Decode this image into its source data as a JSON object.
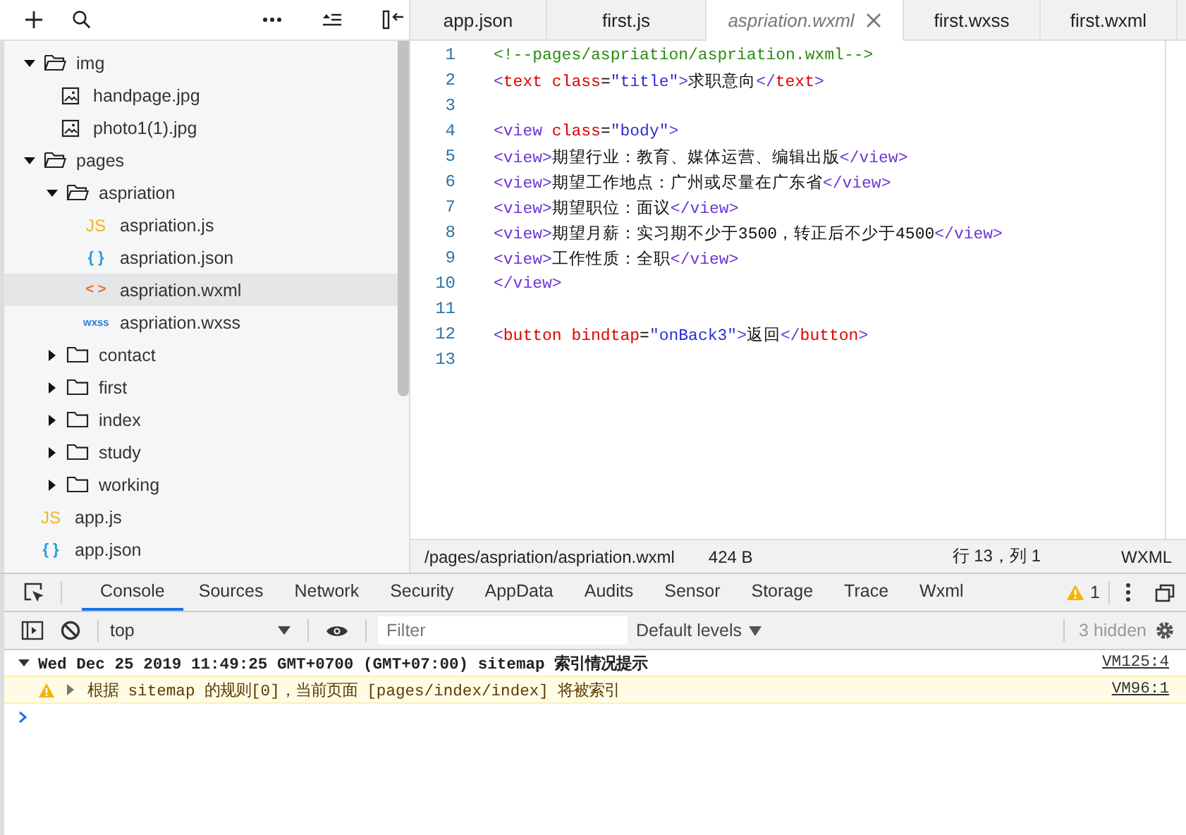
{
  "sidebar": {
    "tree": [
      {
        "name": "img",
        "kind": "folder",
        "expanded": true,
        "selected": false,
        "children": [
          {
            "name": "handpage.jpg",
            "kind": "image",
            "selected": false
          },
          {
            "name": "photo1(1).jpg",
            "kind": "image",
            "selected": false
          }
        ]
      },
      {
        "name": "pages",
        "kind": "folder",
        "expanded": true,
        "selected": false,
        "children": [
          {
            "name": "aspriation",
            "kind": "folder",
            "expanded": true,
            "selected": false,
            "children": [
              {
                "name": "aspriation.js",
                "kind": "js",
                "badge": "JS",
                "selected": false
              },
              {
                "name": "aspriation.json",
                "kind": "json",
                "badge": "{ }",
                "selected": false
              },
              {
                "name": "aspriation.wxml",
                "kind": "wxml",
                "badge": "< >",
                "selected": true
              },
              {
                "name": "aspriation.wxss",
                "kind": "wxss",
                "badge": "wxss",
                "selected": false
              }
            ]
          },
          {
            "name": "contact",
            "kind": "folder",
            "expanded": false,
            "selected": false
          },
          {
            "name": "first",
            "kind": "folder",
            "expanded": false,
            "selected": false
          },
          {
            "name": "index",
            "kind": "folder",
            "expanded": false,
            "selected": false
          },
          {
            "name": "study",
            "kind": "folder",
            "expanded": false,
            "selected": false
          },
          {
            "name": "working",
            "kind": "folder",
            "expanded": false,
            "selected": false
          }
        ]
      },
      {
        "name": "app.js",
        "kind": "js",
        "badge": "JS",
        "selected": false
      },
      {
        "name": "app.json",
        "kind": "json",
        "badge": "{ }",
        "selected": false
      }
    ]
  },
  "editor": {
    "tabs": [
      {
        "label": "app.json",
        "selected": false
      },
      {
        "label": "first.js",
        "selected": false
      },
      {
        "label": "aspriation.wxml",
        "selected": true
      },
      {
        "label": "first.wxss",
        "selected": false
      },
      {
        "label": "first.wxml",
        "selected": false
      }
    ],
    "lines": [
      {
        "number": "1",
        "tokens": [
          {
            "kind": "comment",
            "text": "<!--pages/aspriation/aspriation.wxml-->"
          }
        ]
      },
      {
        "number": "2",
        "tokens": [
          {
            "kind": "punct",
            "text": "<"
          },
          {
            "kind": "keyword",
            "text": "text"
          },
          {
            "kind": "keyword",
            "text": " class"
          },
          {
            "kind": "text",
            "text": "="
          },
          {
            "kind": "string",
            "text": "\"title\""
          },
          {
            "kind": "punct",
            "text": ">"
          },
          {
            "kind": "text",
            "text": "求职意向"
          },
          {
            "kind": "punct",
            "text": "</"
          },
          {
            "kind": "keyword",
            "text": "text"
          },
          {
            "kind": "punct",
            "text": ">"
          }
        ]
      },
      {
        "number": "3"
      },
      {
        "number": "4",
        "tokens": [
          {
            "kind": "tag",
            "text": "<view"
          },
          {
            "kind": "keyword",
            "text": " class"
          },
          {
            "kind": "text",
            "text": "="
          },
          {
            "kind": "string",
            "text": "\"body\""
          },
          {
            "kind": "tag",
            "text": ">"
          }
        ]
      },
      {
        "number": "5",
        "tokens": [
          {
            "kind": "tag",
            "text": "<view>"
          },
          {
            "kind": "text",
            "text": "期望行业：教育、媒体运营、编辑出版"
          },
          {
            "kind": "tag",
            "text": "</view>"
          }
        ]
      },
      {
        "number": "6",
        "tokens": [
          {
            "kind": "tag",
            "text": "<view>"
          },
          {
            "kind": "text",
            "text": "期望工作地点：广州或尽量在广东省"
          },
          {
            "kind": "tag",
            "text": "</view>"
          }
        ]
      },
      {
        "number": "7",
        "tokens": [
          {
            "kind": "tag",
            "text": "<view>"
          },
          {
            "kind": "text",
            "text": "期望职位：面议"
          },
          {
            "kind": "tag",
            "text": "</view>"
          }
        ]
      },
      {
        "number": "8",
        "tokens": [
          {
            "kind": "tag",
            "text": "<view>"
          },
          {
            "kind": "text",
            "text": "期望月薪：实习期不少于3500，转正后不少于4500"
          },
          {
            "kind": "tag",
            "text": "</view>"
          }
        ]
      },
      {
        "number": "9",
        "tokens": [
          {
            "kind": "tag",
            "text": "<view>"
          },
          {
            "kind": "text",
            "text": "工作性质：全职"
          },
          {
            "kind": "tag",
            "text": "</view>"
          }
        ]
      },
      {
        "number": "10",
        "tokens": [
          {
            "kind": "tag",
            "text": "</view>"
          }
        ]
      },
      {
        "number": "11"
      },
      {
        "number": "12",
        "tokens": [
          {
            "kind": "punct",
            "text": "<"
          },
          {
            "kind": "keyword",
            "text": "button"
          },
          {
            "kind": "keyword",
            "text": " bindtap"
          },
          {
            "kind": "text",
            "text": "="
          },
          {
            "kind": "string",
            "text": "\"onBack3\""
          },
          {
            "kind": "punct",
            "text": ">"
          },
          {
            "kind": "text",
            "text": "返回"
          },
          {
            "kind": "punct",
            "text": "</"
          },
          {
            "kind": "keyword",
            "text": "button"
          },
          {
            "kind": "punct",
            "text": ">"
          }
        ]
      },
      {
        "number": "13"
      }
    ],
    "status_bar": {
      "path": "/pages/aspriation/aspriation.wxml",
      "size": "424 B",
      "position": "行 13，列 1",
      "language": "WXML"
    }
  },
  "devtools": {
    "tabs": [
      {
        "label": "Console",
        "selected": true
      },
      {
        "label": "Sources",
        "selected": false
      },
      {
        "label": "Network",
        "selected": false
      },
      {
        "label": "Security",
        "selected": false
      },
      {
        "label": "AppData",
        "selected": false
      },
      {
        "label": "Audits",
        "selected": false
      },
      {
        "label": "Sensor",
        "selected": false
      },
      {
        "label": "Storage",
        "selected": false
      },
      {
        "label": "Trace",
        "selected": false
      },
      {
        "label": "Wxml",
        "selected": false
      }
    ],
    "warning_count": "1",
    "toolbar": {
      "context": "top",
      "filter_placeholder": "Filter",
      "levels": "Default levels",
      "hidden": "3 hidden"
    },
    "messages": [
      {
        "kind": "group",
        "expanded": true,
        "text": "Wed Dec 25 2019 11:49:25 GMT+0700 (GMT+07:00) sitemap 索引情况提示",
        "source": "VM125:4"
      },
      {
        "kind": "warning",
        "expanded": false,
        "text": "根据 sitemap 的规则[0]，当前页面 [pages/index/index] 将被索引",
        "source": "VM96:1"
      }
    ]
  }
}
